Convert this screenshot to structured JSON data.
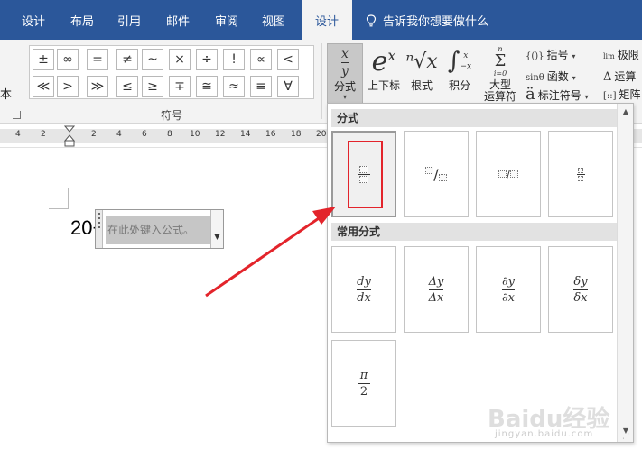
{
  "tabs": [
    {
      "label": "设计",
      "active": false
    },
    {
      "label": "布局",
      "active": false
    },
    {
      "label": "引用",
      "active": false
    },
    {
      "label": "邮件",
      "active": false
    },
    {
      "label": "审阅",
      "active": false
    },
    {
      "label": "视图",
      "active": false
    },
    {
      "label": "设计",
      "active": true
    }
  ],
  "tell_me": "告诉我你想要做什么",
  "ribbon": {
    "left_cut_label": "本",
    "symbols_group_label": "符号",
    "symbols": [
      "±",
      "∞",
      "=",
      "≠",
      "~",
      "×",
      "÷",
      "!",
      "∝",
      "<",
      "≪",
      ">",
      "≫",
      "≤",
      "≥",
      "∓",
      "≅",
      "≈",
      "≡",
      "∀"
    ],
    "buttons": {
      "fraction": {
        "label": "分式",
        "icon_num": "x",
        "icon_den": "y"
      },
      "script": {
        "label": "上下标",
        "icon": "e",
        "icon_sup": "x"
      },
      "radical": {
        "label": "根式",
        "icon": "ⁿ√x"
      },
      "integral": {
        "label": "积分",
        "icon": "∫",
        "icon_upper": "x",
        "icon_lower": "−x"
      },
      "large_operator": {
        "label_line1": "大型",
        "label_line2": "运算符",
        "icon_upper": "n",
        "icon": "Σ",
        "icon_lower": "i=0"
      },
      "bracket": {
        "label": "括号",
        "icon": "{()}"
      },
      "function": {
        "label": "函数",
        "icon": "sinθ"
      },
      "accent": {
        "label": "标注符号",
        "icon": "ä"
      },
      "limit": {
        "label": "极限",
        "icon": "lim"
      },
      "operator": {
        "label": "运算",
        "icon": "Δ"
      },
      "matrix": {
        "label": "矩阵",
        "icon": "[::]"
      }
    }
  },
  "ruler": {
    "numbers": [
      "4",
      "2",
      "2",
      "4",
      "6",
      "8",
      "10",
      "12",
      "14",
      "16",
      "18",
      "20"
    ]
  },
  "document": {
    "text": "20+",
    "equation_placeholder": "在此处键入公式。"
  },
  "gallery": {
    "section_fraction": "分式",
    "section_common": "常用分式",
    "common": [
      {
        "num": "dy",
        "den": "dx"
      },
      {
        "num": "Δy",
        "den": "Δx"
      },
      {
        "num": "∂y",
        "den": "∂x"
      },
      {
        "num": "δy",
        "den": "δx"
      },
      {
        "num": "π",
        "den": "2"
      }
    ]
  },
  "colors": {
    "tab_bar": "#2b579a",
    "annotation_red": "#e3242b"
  },
  "watermark": {
    "main": "Baidu经验",
    "sub": "jingyan.baidu.com"
  }
}
